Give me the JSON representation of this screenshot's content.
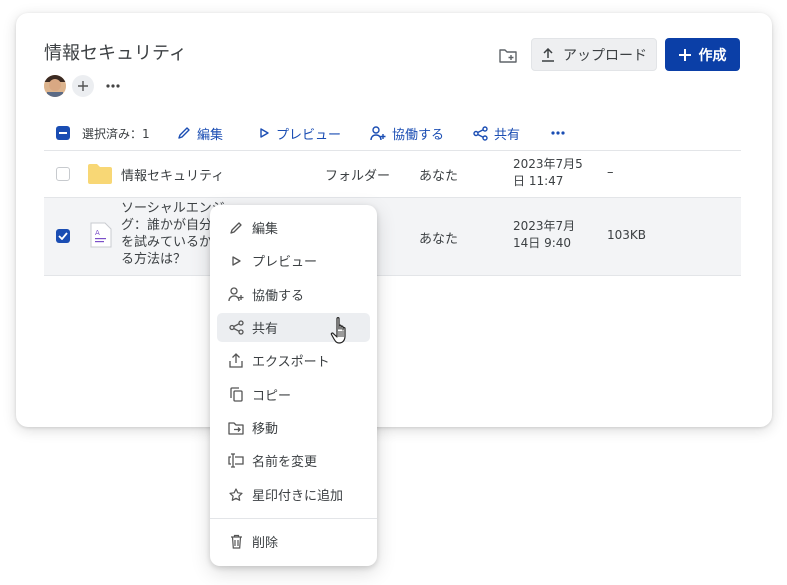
{
  "header": {
    "title": "情報セキュリティ",
    "upload_label": "アップロード",
    "create_label": "作成"
  },
  "toolbar": {
    "selected_label": "選択済み：1",
    "edit_label": "編集",
    "preview_label": "プレビュー",
    "collaborate_label": "協働する",
    "share_label": "共有"
  },
  "files": [
    {
      "name": "情報セキュリティ",
      "type": "フォルダー",
      "owner": "あなた",
      "modified_line1": "2023年7月5",
      "modified_line2": "日 11:47",
      "size": "–",
      "checked": false
    },
    {
      "name_line1": "ソーシャルエンジ",
      "name_line2": "グ：誰かが自分",
      "name_line3": "を試みているか",
      "name_line4": "る方法は？",
      "owner": "あなた",
      "modified_line1": "2023年7月",
      "modified_line2": "14日 9:40",
      "size": "103KB",
      "checked": true
    }
  ],
  "context_menu": {
    "items": [
      {
        "label": "編集",
        "icon": "pencil-icon"
      },
      {
        "label": "プレビュー",
        "icon": "play-outline-icon"
      },
      {
        "label": "協働する",
        "icon": "person-add-icon"
      },
      {
        "label": "共有",
        "icon": "share-icon"
      },
      {
        "label": "エクスポート",
        "icon": "export-icon"
      },
      {
        "label": "コピー",
        "icon": "copy-icon"
      },
      {
        "label": "移動",
        "icon": "move-folder-icon"
      },
      {
        "label": "名前を変更",
        "icon": "rename-icon"
      },
      {
        "label": "星印付きに追加",
        "icon": "star-icon"
      },
      {
        "label": "削除",
        "icon": "trash-icon"
      }
    ],
    "hovered_item": "共有"
  },
  "colors": {
    "accent": "#1a4db3",
    "create_button": "#0b3fa7",
    "folder": "#f8d775",
    "selected_row": "#f3f4f6"
  }
}
